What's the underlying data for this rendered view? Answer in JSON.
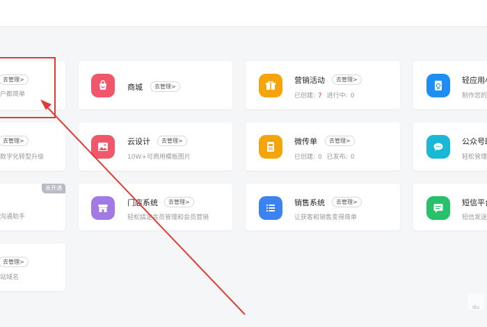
{
  "cards": {
    "c1": {
      "manage": "去管理>",
      "sub": "户都简单"
    },
    "mall": {
      "title": "商城",
      "manage": "去管理>"
    },
    "marketing": {
      "title": "营销活动",
      "manage": "去管理>",
      "created_label": "已创建:",
      "created": "7",
      "running_label": "进行中:",
      "running": "0"
    },
    "lightapp": {
      "title": "轻应用小",
      "sub": "制作您的"
    },
    "c2": {
      "manage": "去管理>",
      "sub": "数字化转型升级"
    },
    "design": {
      "title": "云设计",
      "manage": "去管理>",
      "sub": "10W+可商用模板图片"
    },
    "flyer": {
      "title": "微传单",
      "manage": "去管理>",
      "created_label": "已创建:",
      "created": "0",
      "published_label": "已发布:",
      "published": "0"
    },
    "official": {
      "title": "公众号助",
      "sub": "轻松管理"
    },
    "c3": {
      "badge": "未开通",
      "sub": "沟通助手"
    },
    "store": {
      "title": "门店系统",
      "manage": "去管理>",
      "sub": "轻松搞定会员管理和会员营销"
    },
    "sales": {
      "title": "销售系统",
      "manage": "去管理>",
      "sub": "让获客和销售变得简单"
    },
    "sms": {
      "title": "短信平台",
      "sub": "短信发送"
    },
    "c4": {
      "manage": "去管理>",
      "sub": "站域名"
    }
  },
  "colors": {
    "mall": "#f0576a",
    "marketing": "#f5a50b",
    "lightapp": "#1e8ef5",
    "design": "#f0576a",
    "flyer": "#f5a50b",
    "official": "#1ab8d6",
    "store": "#a27ae6",
    "sales": "#3c82f0",
    "sms": "#27c16b",
    "annotation": "#e03a32"
  },
  "watermark": "du"
}
